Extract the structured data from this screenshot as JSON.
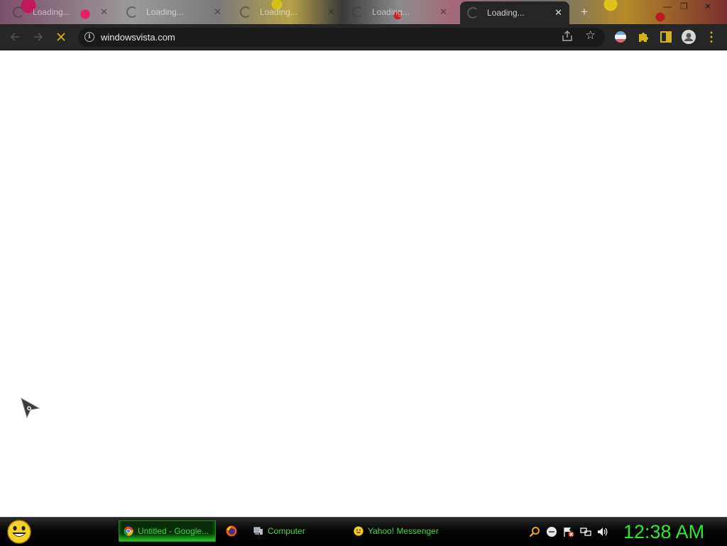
{
  "browser": {
    "tabs": [
      {
        "title": "Loading...",
        "active": false
      },
      {
        "title": "Loading...",
        "active": false
      },
      {
        "title": "Loading...",
        "active": false
      },
      {
        "title": "Loading...",
        "active": false
      },
      {
        "title": "Loading...",
        "active": true
      }
    ],
    "new_tab_glyph": "+",
    "window_controls": {
      "minimize": "—",
      "restore": "❐",
      "close": "✕"
    },
    "toolbar": {
      "back_icon": "arrow-left-icon",
      "forward_icon": "arrow-right-icon",
      "stop_icon": "close-icon",
      "url": "windowsvista.com",
      "share_icon": "share-icon",
      "bookmark_icon": "star-icon",
      "extensions": [
        "flag-extension-icon",
        "puzzle-icon",
        "side-panel-icon",
        "profile-avatar-icon"
      ],
      "menu_glyph": "⋮"
    }
  },
  "taskbar": {
    "start_icon": "smiley-orb-icon",
    "items": [
      {
        "label": "Untitled - Google...",
        "icon": "chrome-icon",
        "active": true
      },
      {
        "label": "",
        "icon": "firefox-icon",
        "active": false
      },
      {
        "label": "Computer",
        "icon": "computer-icon",
        "active": false
      },
      {
        "label": "Yahoo! Messenger",
        "icon": "yahoo-messenger-icon",
        "active": false
      }
    ],
    "tray_icons": [
      "search-icon",
      "status-icon",
      "action-center-flag-icon",
      "network-icon",
      "volume-icon"
    ],
    "clock": "12:38 AM"
  },
  "colors": {
    "taskbar_text": "#3ddc3d",
    "clock": "#2ee82e",
    "toolbar_bg": "#262626",
    "extension_accent": "#d4b21a"
  }
}
